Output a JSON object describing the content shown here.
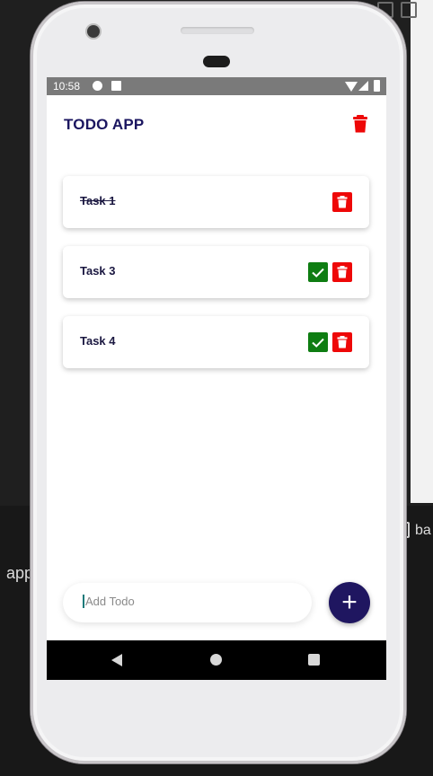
{
  "status_bar": {
    "time": "10:58"
  },
  "app": {
    "title": "TODO APP",
    "clear_all_icon": "trash-icon",
    "accent_color": "#1b1660",
    "check_color": "#0e7d12",
    "delete_color": "#ee0808"
  },
  "tasks": [
    {
      "label": "Task 1",
      "completed": true
    },
    {
      "label": "Task 3",
      "completed": false
    },
    {
      "label": "Task 4",
      "completed": false
    }
  ],
  "input": {
    "placeholder": "Add Todo",
    "value": ""
  },
  "add_button": {
    "label": "+"
  },
  "background": {
    "left_text": "app",
    "right_text": "ba"
  }
}
